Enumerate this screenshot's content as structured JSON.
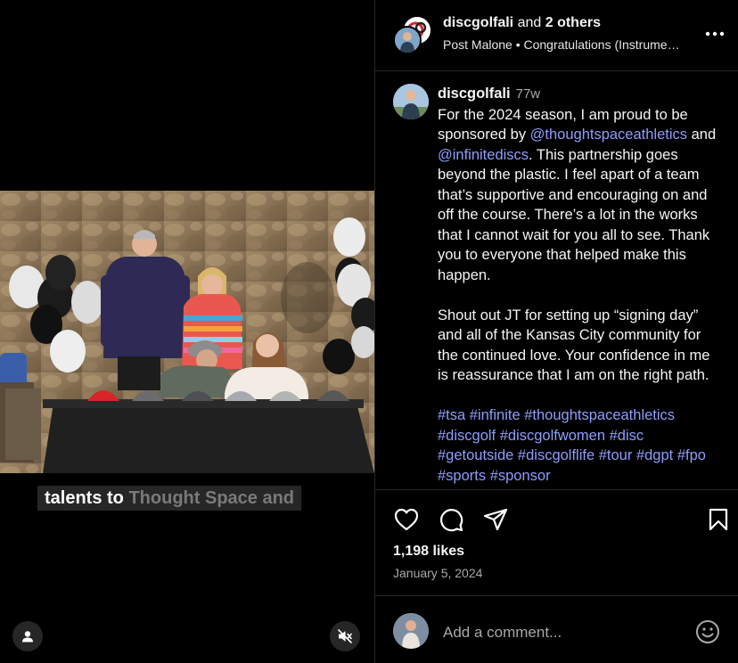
{
  "video": {
    "caption_bright": "talents to",
    "caption_dim": "Thought Space and",
    "user_icon": "user-tags-icon",
    "mute_icon": "muted-speaker-icon"
  },
  "header": {
    "username": "discgolfali",
    "and_text": "and",
    "others": "2 others",
    "audio": "Post Malone • Congratulations (Instrume…",
    "more_icon": "more-options-icon"
  },
  "post": {
    "username": "discgolfali",
    "time": "77w",
    "p1_a": "For the 2024 season, I am proud to be sponsored by ",
    "mention1": "@thoughtspaceathletics",
    "p1_b": " and ",
    "mention2": "@infinitediscs",
    "p1_c": ". This partnership goes beyond the plastic. I feel apart of a team that’s supportive and encouraging on and off the course. There’s a lot in the works that I cannot wait for you all to see. Thank you to everyone that helped make this happen.",
    "p2": "Shout out JT for setting up “signing day” and all of the Kansas City community for the continued love. Your confidence in me is reassurance that I am on the right path.",
    "hashtags": [
      "#tsa",
      "#infinite",
      "#thoughtspaceathletics",
      "#discgolf",
      "#discgolfwomen",
      "#disc",
      "#getoutside",
      "#discgolflife",
      "#tour",
      "#dgpt",
      "#fpo",
      "#sports",
      "#sponsor"
    ]
  },
  "actions": {
    "likes": "1,198 likes",
    "date": "January 5, 2024"
  },
  "comment": {
    "placeholder": "Add a comment..."
  },
  "colors": {
    "link": "#8f9dfb",
    "muted_text": "#a8a8a8",
    "border": "#262626",
    "background": "#000000"
  }
}
